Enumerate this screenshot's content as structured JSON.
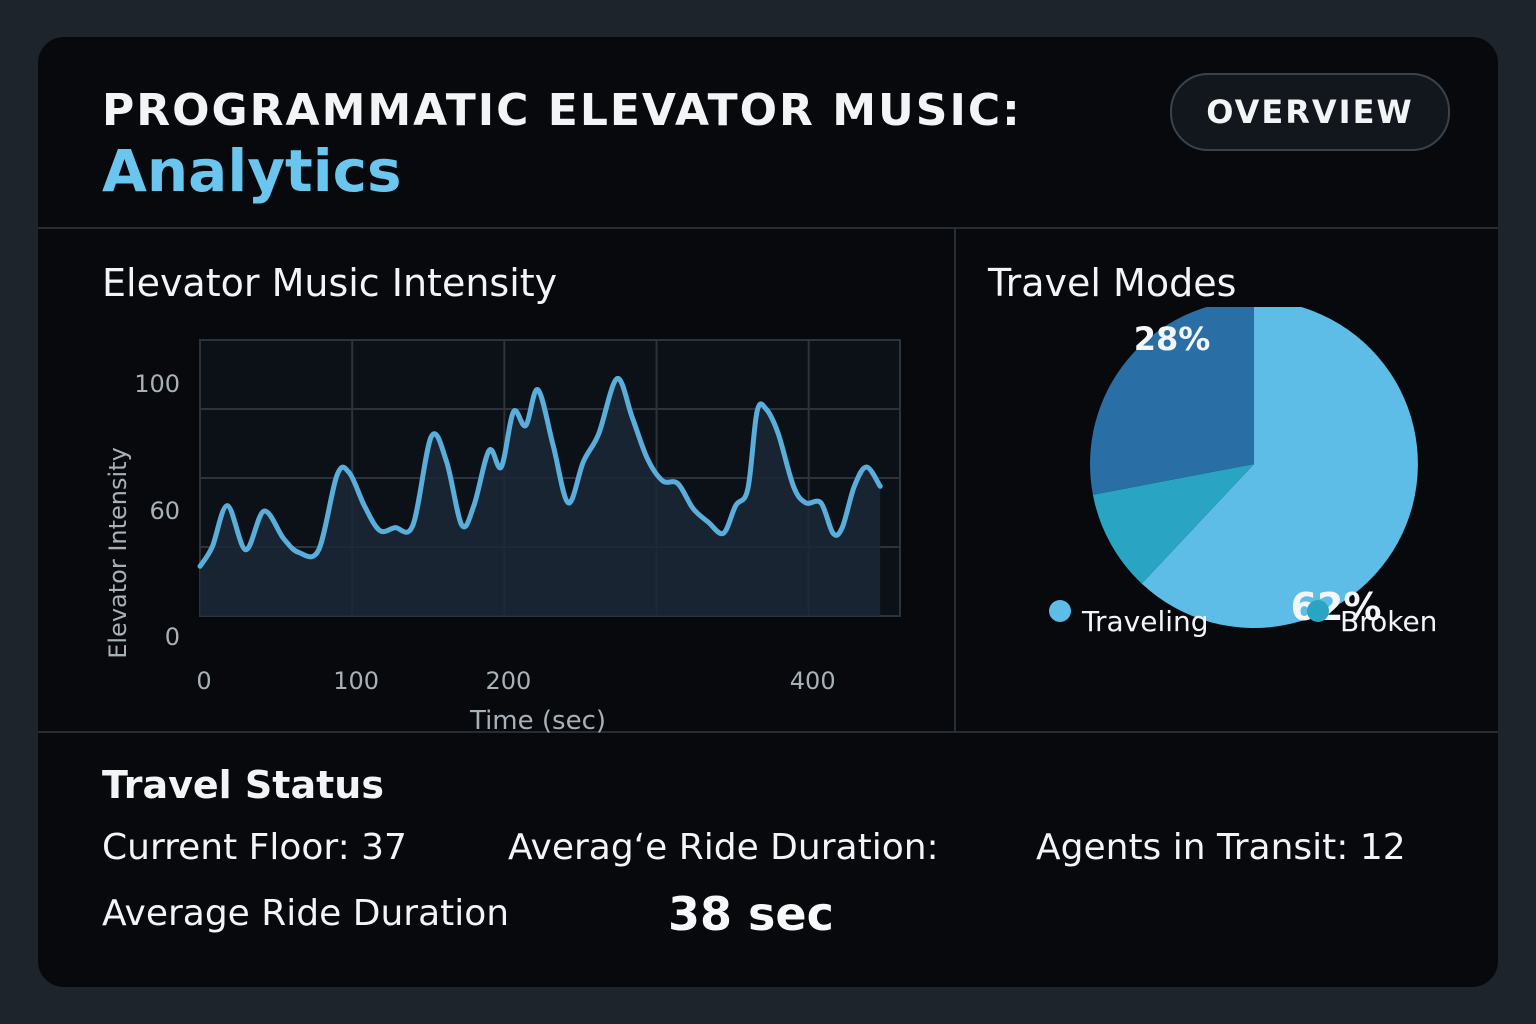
{
  "header": {
    "title_line1": "PROGRAMMATIC ELEVATOR MUSIC:",
    "title_line2": "Analytics",
    "overview_button": "OVERVIEW"
  },
  "intensity_section": {
    "title": "Elevator Music Intensity"
  },
  "travel_modes_section": {
    "title": "Travel Modes"
  },
  "travel_status": {
    "title": "Travel Status",
    "current_floor": "Current Floor: 37",
    "avg_ride_label_1": "Averagʻe Ride Duration:",
    "agents_in_transit": "Agents in Transit: 12",
    "avg_ride_label_2": "Average Ride Duration",
    "avg_ride_value": "38 sec"
  },
  "colors": {
    "accent": "#6ac6ee",
    "line": "#5aaedb",
    "pie_traveling": "#5dbde6",
    "pie_dark": "#2a6ea6",
    "pie_broken": "#29a4c2"
  },
  "chart_data": [
    {
      "type": "area",
      "xlabel": "Time (sec)",
      "ylabel": "Elevator Intensity",
      "xlim": [
        0,
        460
      ],
      "ylim": [
        0,
        100
      ],
      "xticks": [
        0,
        100,
        200,
        400
      ],
      "xtick_labels": [
        "0",
        "100",
        "200",
        "400"
      ],
      "yticks": [
        0,
        60,
        100
      ],
      "ytick_labels": [
        "0",
        "60",
        "100"
      ],
      "grid": true,
      "x": [
        0,
        8,
        18,
        30,
        42,
        55,
        65,
        78,
        90,
        98,
        108,
        118,
        128,
        140,
        152,
        162,
        172,
        180,
        190,
        198,
        206,
        214,
        222,
        232,
        242,
        252,
        262,
        274,
        284,
        294,
        304,
        314,
        324,
        334,
        344,
        352,
        360,
        366,
        372,
        380,
        390,
        398,
        408,
        416,
        422,
        430,
        438,
        447
      ],
      "y": [
        18,
        25,
        40,
        24,
        38,
        28,
        23,
        24,
        51,
        52,
        40,
        31,
        32,
        33,
        65,
        56,
        33,
        40,
        60,
        54,
        74,
        69,
        82,
        62,
        41,
        56,
        66,
        86,
        72,
        57,
        49,
        48,
        39,
        34,
        30,
        40,
        46,
        74,
        75,
        66,
        47,
        41,
        41,
        30,
        32,
        47,
        54,
        47
      ]
    },
    {
      "type": "pie",
      "slices": [
        {
          "label": "62%",
          "value": 62,
          "color": "#5dbde6"
        },
        {
          "label": "10%",
          "value": 10,
          "color": "#29a4c2"
        },
        {
          "label": "28%",
          "value": 28,
          "color": "#2a6ea6"
        }
      ],
      "legend": [
        {
          "name": "Traveling",
          "color": "#5dbde6"
        },
        {
          "name": "Broken",
          "color": "#29a4c2"
        }
      ],
      "legend_position": "bottom"
    }
  ]
}
